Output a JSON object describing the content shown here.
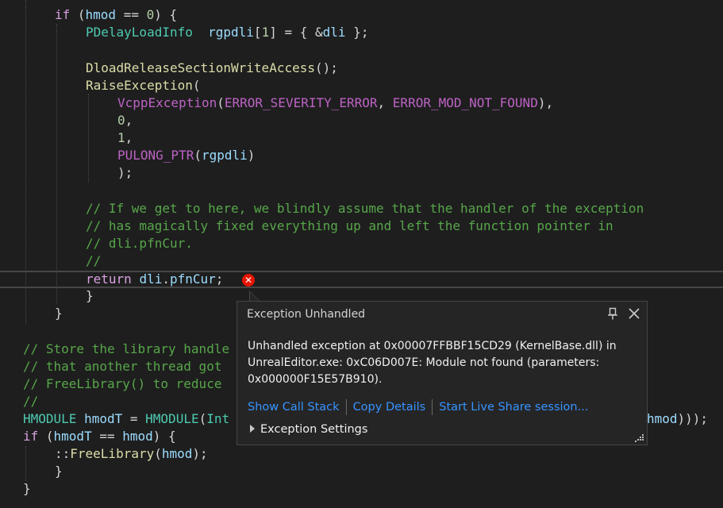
{
  "code": {
    "l1": [
      "if",
      " (",
      "hmod",
      " == ",
      "0",
      ") {"
    ],
    "l2": [
      "PDelayLoadInfo",
      "  ",
      "rgpdli",
      "[",
      "1",
      "] = { &",
      "dli",
      " };"
    ],
    "l4": [
      "DloadReleaseSectionWriteAccess",
      "();"
    ],
    "l5": [
      "RaiseException",
      "("
    ],
    "l6": [
      "VcppException",
      "(",
      "ERROR_SEVERITY_ERROR",
      ", ",
      "ERROR_MOD_NOT_FOUND",
      "),"
    ],
    "l7": [
      "0",
      ","
    ],
    "l8": [
      "1",
      ","
    ],
    "l9": [
      "PULONG_PTR",
      "(",
      "rgpdli",
      ")"
    ],
    "l10": ");",
    "c1": "// If we get to here, we blindly assume that the handler of the exception",
    "c2": "// has magically fixed everything up and left the function pointer in",
    "c3": "// dli.pfnCur.",
    "c4": "//",
    "l15": [
      "return",
      " ",
      "dli",
      ".",
      "pfnCur",
      ";"
    ],
    "l16": "}",
    "l17": "}",
    "c5": "// Store the library handle",
    "c6": "// that another thread got",
    "c7": "// FreeLibrary() to reduce",
    "c8": "//",
    "l23": [
      "HMODULE",
      " ",
      "hmodT",
      " = ",
      "HMODULE",
      "(",
      "Int"
    ],
    "l23tail": [
      "hmod",
      ")));"
    ],
    "l24": [
      "if",
      " (",
      "hmodT",
      " == ",
      "hmod",
      ") {"
    ],
    "l25": [
      "::",
      "FreeLibrary",
      "(",
      "hmod",
      ");"
    ],
    "l26": "}",
    "l27": "}"
  },
  "popup": {
    "title": "Exception Unhandled",
    "message_l1": "Unhandled exception at 0x00007FFBBF15CD29 (KernelBase.dll) in",
    "message_l2": "UnrealEditor.exe: 0xC06D007E: Module not found (parameters:",
    "message_l3": "0x000000F15E57B910).",
    "link_call_stack": "Show Call Stack",
    "link_copy": "Copy Details",
    "link_live_share": "Start Live Share session...",
    "settings_label": "Exception Settings",
    "error_glyph": "✕"
  }
}
